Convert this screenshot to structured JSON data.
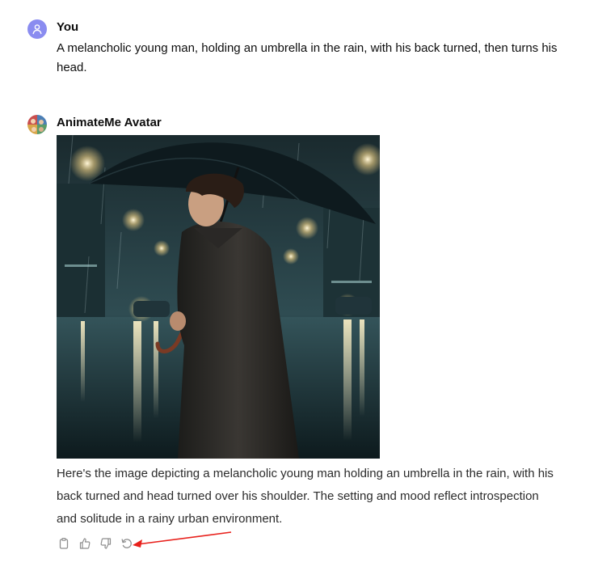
{
  "user_message": {
    "author": "You",
    "text": "A melancholic young man, holding an umbrella in the rain, with his back turned, then turns his head."
  },
  "assistant_message": {
    "author": "AnimateMe Avatar",
    "text": "Here's the image depicting a melancholic young man holding an umbrella in the rain, with his back turned and head turned over his shoulder. The setting and mood reflect introspection and solitude in a rainy urban environment."
  },
  "actions": {
    "icons": [
      "copy-icon",
      "thumbs-up-icon",
      "thumbs-down-icon",
      "regenerate-icon"
    ]
  },
  "colors": {
    "user_avatar": "#8a8cf0",
    "annotation_arrow": "#e8201b",
    "icon": "#8e8e8e"
  }
}
